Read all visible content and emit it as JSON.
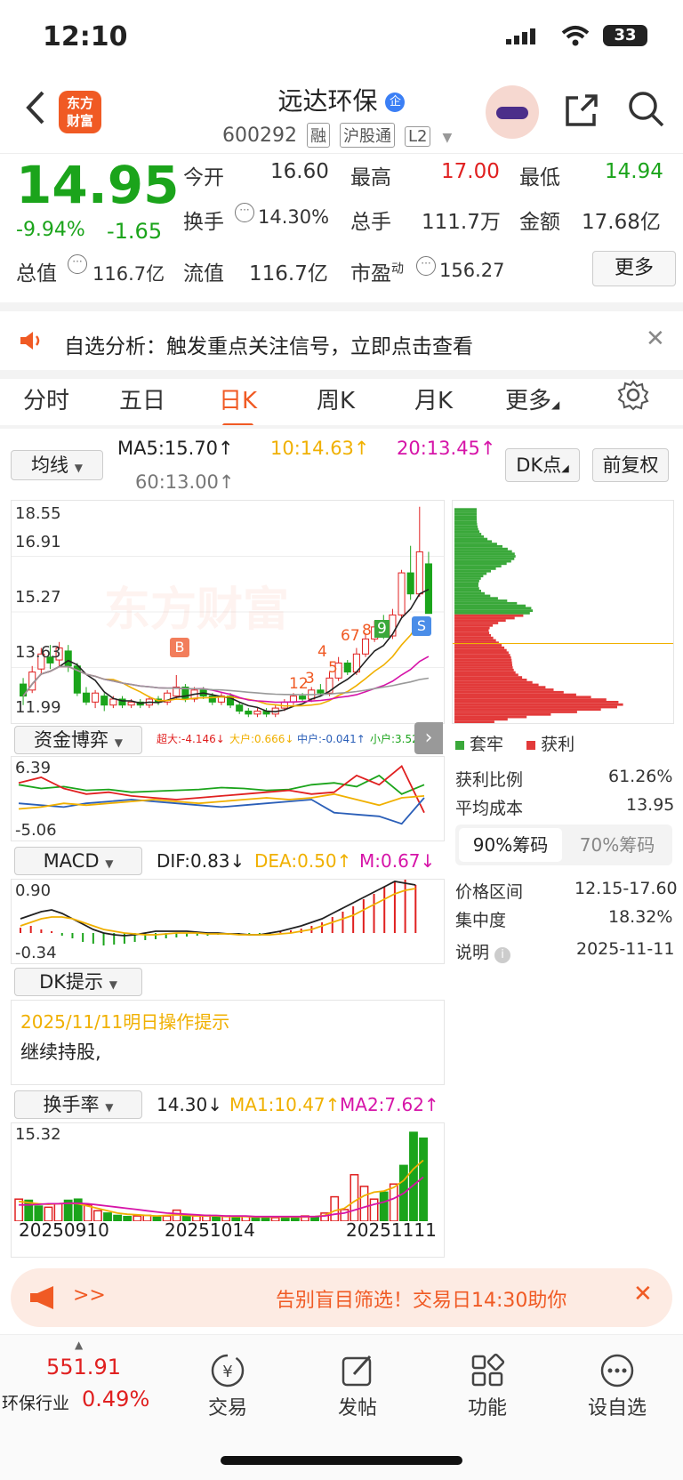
{
  "status_bar": {
    "time": "12:10",
    "battery": "33"
  },
  "header": {
    "back_icon": "chevron-left-icon",
    "app_logo_text": "东方\n财富",
    "stock_name": "远达环保",
    "badge": "企",
    "stock_code": "600292",
    "tags": [
      "融",
      "沪股通",
      "L2"
    ],
    "share_icon": "share-icon",
    "search_icon": "search-icon"
  },
  "quote": {
    "price": "14.95",
    "change_pct": "-9.94%",
    "change": "-1.65",
    "open_label": "今开",
    "open": "16.60",
    "high_label": "最高",
    "high": "17.00",
    "low_label": "最低",
    "low": "14.94",
    "turnover_label": "换手",
    "turnover": "14.30%",
    "volume_label": "总手",
    "volume": "111.7万",
    "amount_label": "金额",
    "amount": "17.68亿",
    "mcap_label": "总值",
    "mcap": "116.7亿",
    "float_label": "流值",
    "float": "116.7亿",
    "pe_label": "市盈",
    "pe_sup": "动",
    "pe": "156.27",
    "more_label": "更多",
    "colors": {
      "up": "#e02020",
      "down": "#1ba41b"
    }
  },
  "notice": {
    "text": "自选分析：触发重点关注信号，立即点击查看",
    "close_icon": "close-icon"
  },
  "tabs": [
    {
      "label": "分时"
    },
    {
      "label": "五日"
    },
    {
      "label": "日K"
    },
    {
      "label": "周K"
    },
    {
      "label": "月K"
    },
    {
      "label": "更多"
    }
  ],
  "indicator_bar": {
    "ma_select": "均线",
    "ma5": "MA5:15.70↑",
    "ma10": "10:14.63↑",
    "ma20": "20:13.45↑",
    "ma60": "60:13.00↑",
    "dk_point": "DK点",
    "adjust": "前复权"
  },
  "kline": {
    "y_labels": [
      "18.55",
      "16.91",
      "15.27",
      "13.63",
      "11.99"
    ],
    "signal_b": "B",
    "signal_s": "S",
    "seq_labels": [
      "12",
      "3",
      "4",
      "5",
      "67",
      "8",
      "9"
    ],
    "watermark": "东方财富",
    "candles": [
      {
        "o": 12.6,
        "c": 12.2,
        "h": 12.8,
        "l": 11.9
      },
      {
        "o": 12.4,
        "c": 13.0,
        "h": 13.2,
        "l": 12.3
      },
      {
        "o": 13.1,
        "c": 13.6,
        "h": 13.8,
        "l": 12.9
      },
      {
        "o": 13.5,
        "c": 13.3,
        "h": 13.9,
        "l": 13.1
      },
      {
        "o": 13.4,
        "c": 13.8,
        "h": 14.0,
        "l": 13.2
      },
      {
        "o": 13.7,
        "c": 13.2,
        "h": 13.9,
        "l": 13.0
      },
      {
        "o": 13.2,
        "c": 12.3,
        "h": 13.3,
        "l": 12.2
      },
      {
        "o": 12.3,
        "c": 12.0,
        "h": 12.5,
        "l": 11.9
      },
      {
        "o": 12.0,
        "c": 12.3,
        "h": 12.4,
        "l": 11.8
      },
      {
        "o": 12.2,
        "c": 11.9,
        "h": 12.3,
        "l": 11.7
      },
      {
        "o": 11.9,
        "c": 12.1,
        "h": 12.2,
        "l": 11.8
      },
      {
        "o": 12.1,
        "c": 11.9,
        "h": 12.2,
        "l": 11.8
      },
      {
        "o": 11.9,
        "c": 12.0,
        "h": 12.1,
        "l": 11.8
      },
      {
        "o": 12.0,
        "c": 11.9,
        "h": 12.1,
        "l": 11.8
      },
      {
        "o": 11.9,
        "c": 12.1,
        "h": 12.2,
        "l": 11.8
      },
      {
        "o": 12.1,
        "c": 12.0,
        "h": 12.2,
        "l": 11.9
      },
      {
        "o": 12.0,
        "c": 12.3,
        "h": 12.4,
        "l": 11.9
      },
      {
        "o": 12.2,
        "c": 12.5,
        "h": 12.9,
        "l": 12.1
      },
      {
        "o": 12.5,
        "c": 12.1,
        "h": 12.6,
        "l": 12.0
      },
      {
        "o": 12.1,
        "c": 12.4,
        "h": 12.5,
        "l": 12.0
      },
      {
        "o": 12.4,
        "c": 12.2,
        "h": 12.5,
        "l": 12.1
      },
      {
        "o": 12.2,
        "c": 12.0,
        "h": 12.3,
        "l": 11.9
      },
      {
        "o": 12.0,
        "c": 12.2,
        "h": 12.3,
        "l": 11.9
      },
      {
        "o": 12.2,
        "c": 11.9,
        "h": 12.3,
        "l": 11.8
      },
      {
        "o": 11.9,
        "c": 11.7,
        "h": 12.0,
        "l": 11.6
      },
      {
        "o": 11.7,
        "c": 11.6,
        "h": 11.8,
        "l": 11.5
      },
      {
        "o": 11.6,
        "c": 11.7,
        "h": 11.8,
        "l": 11.5
      },
      {
        "o": 11.7,
        "c": 11.6,
        "h": 11.8,
        "l": 11.5
      },
      {
        "o": 11.6,
        "c": 11.8,
        "h": 11.9,
        "l": 11.5
      },
      {
        "o": 11.8,
        "c": 12.0,
        "h": 12.1,
        "l": 11.7
      },
      {
        "o": 12.0,
        "c": 12.2,
        "h": 12.3,
        "l": 11.9
      },
      {
        "o": 12.2,
        "c": 12.1,
        "h": 12.3,
        "l": 12.0
      },
      {
        "o": 12.1,
        "c": 12.4,
        "h": 12.5,
        "l": 12.0
      },
      {
        "o": 12.4,
        "c": 12.3,
        "h": 12.6,
        "l": 12.2
      },
      {
        "o": 12.3,
        "c": 12.8,
        "h": 13.0,
        "l": 12.2
      },
      {
        "o": 12.8,
        "c": 13.3,
        "h": 13.5,
        "l": 12.7
      },
      {
        "o": 13.3,
        "c": 13.0,
        "h": 13.4,
        "l": 12.9
      },
      {
        "o": 13.0,
        "c": 13.6,
        "h": 13.8,
        "l": 12.9
      },
      {
        "o": 13.6,
        "c": 14.1,
        "h": 14.3,
        "l": 13.5
      },
      {
        "o": 14.1,
        "c": 14.5,
        "h": 14.7,
        "l": 14.0
      },
      {
        "o": 14.5,
        "c": 14.2,
        "h": 14.9,
        "l": 14.1
      },
      {
        "o": 14.2,
        "c": 14.9,
        "h": 15.1,
        "l": 14.1
      },
      {
        "o": 14.9,
        "c": 16.3,
        "h": 16.4,
        "l": 14.8
      },
      {
        "o": 16.3,
        "c": 15.6,
        "h": 17.2,
        "l": 15.4
      },
      {
        "o": 15.6,
        "c": 17.0,
        "h": 18.5,
        "l": 15.5
      },
      {
        "o": 16.6,
        "c": 14.95,
        "h": 17.0,
        "l": 14.94
      }
    ]
  },
  "chip_dist": {
    "legend_trapped": "套牢",
    "legend_profit": "获利",
    "profit_ratio_label": "获利比例",
    "profit_ratio": "61.26%",
    "avg_cost_label": "平均成本",
    "avg_cost": "13.95",
    "chip_tabs": [
      "90%筹码",
      "70%筹码"
    ],
    "range_label": "价格区间",
    "range": "12.15-17.60",
    "concentration_label": "集中度",
    "concentration": "18.32%",
    "note_label": "说明",
    "note": "2025-11-11"
  },
  "fund_game": {
    "select": "资金博弈",
    "super": "超大:-4.146↓",
    "large": "大户:0.666↓",
    "mid": "中户:-0.041↑",
    "small": "小户:3.520↑",
    "y_max": "6.39",
    "y_min": "-5.06"
  },
  "macd": {
    "select": "MACD",
    "dif": "DIF:0.83↓",
    "dea": "DEA:0.50↑",
    "m": "M:0.67↓",
    "y_max": "0.90",
    "y_min": "-0.34"
  },
  "dk_hint": {
    "select": "DK提示",
    "date_line": "2025/11/11明日操作提示",
    "text": "继续持股,"
  },
  "turnover_chart": {
    "select": "换手率",
    "value": "14.30↓",
    "ma1": "MA1:10.47↑",
    "ma2": "MA2:7.62↑",
    "y_max": "15.32",
    "x_labels": [
      "20250910",
      "20251014",
      "20251111"
    ]
  },
  "banner": {
    "arrows": ">>",
    "text": "告别盲目筛选！交易日14:30助你",
    "close_icon": "close-icon"
  },
  "bottom_nav": {
    "index_value": "551.91",
    "index_name": "环保行业",
    "index_pct": "0.49%",
    "items": [
      {
        "label": "交易",
        "icon": "yen-exchange-icon"
      },
      {
        "label": "发帖",
        "icon": "edit-icon"
      },
      {
        "label": "功能",
        "icon": "grid-icon"
      },
      {
        "label": "设自选",
        "icon": "more-icon"
      }
    ]
  }
}
